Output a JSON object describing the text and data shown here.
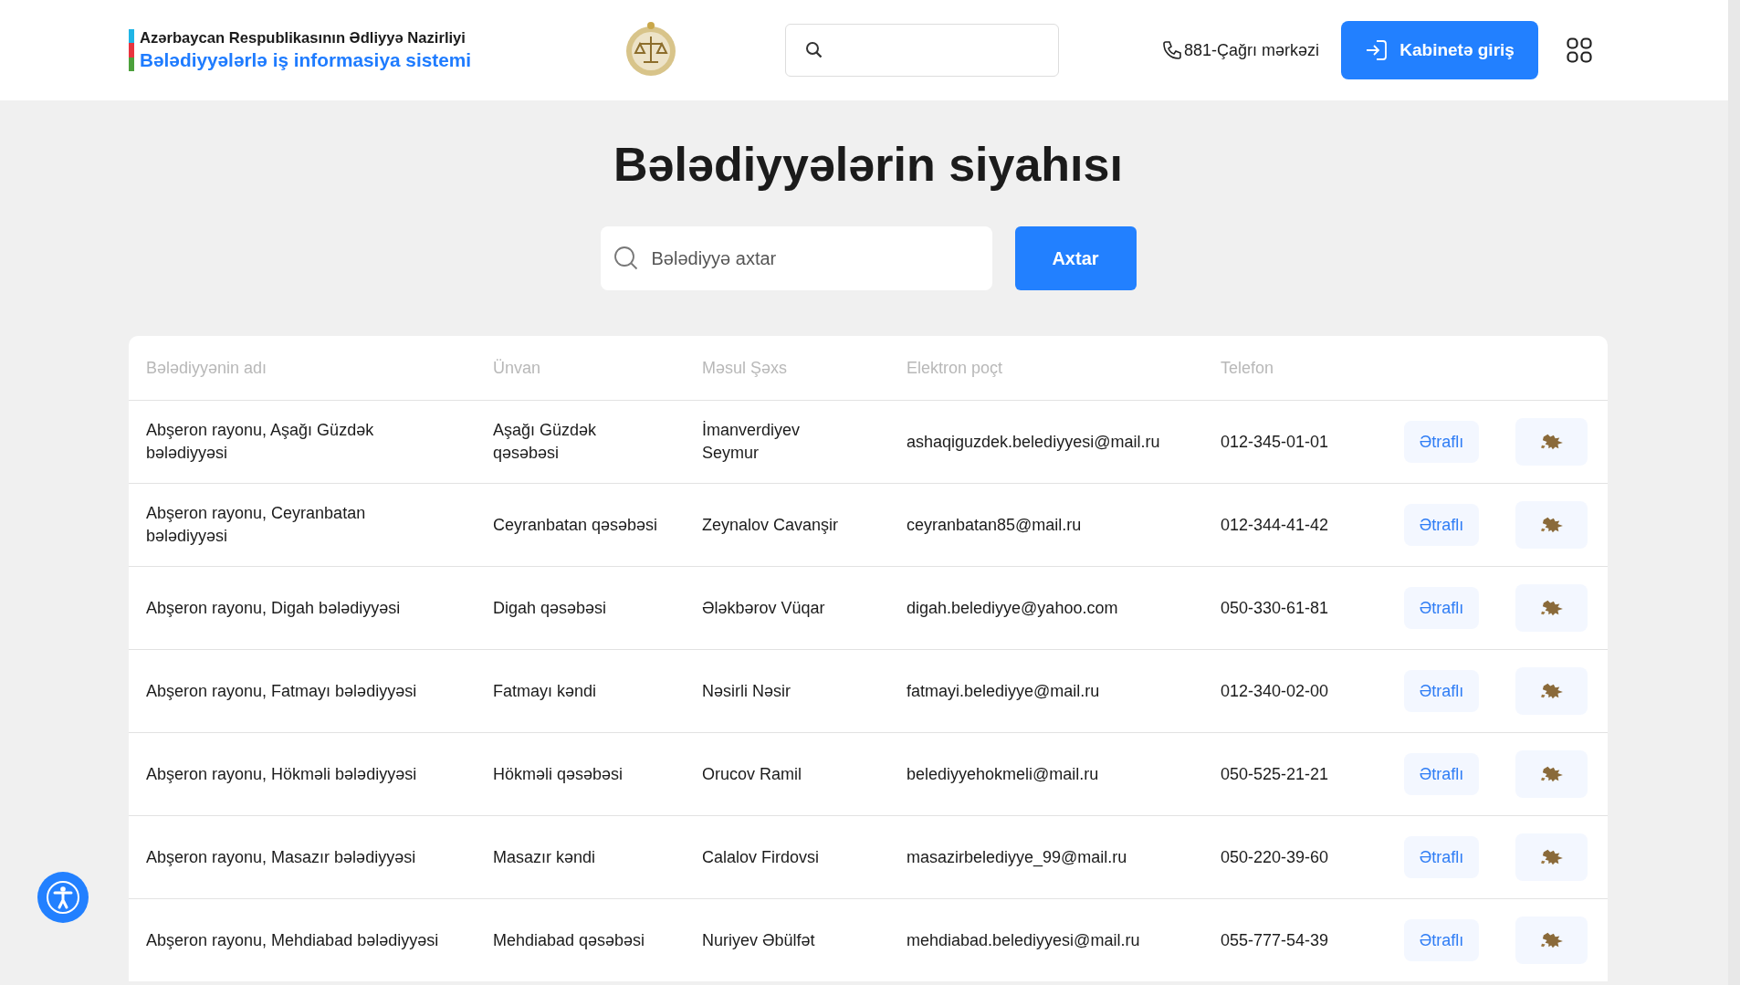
{
  "header": {
    "ministry": "Azərbaycan Respublikasının Ədliyyə Nazirliyi",
    "system": "Bələdiyyələrlə iş informasiya sistemi",
    "call_center": "881-Çağrı mərkəzi",
    "login_button": "Kabinetə giriş"
  },
  "page_title": "Bələdiyyələrin siyahısı",
  "search": {
    "placeholder": "Bələdiyyə axtar",
    "button": "Axtar"
  },
  "table": {
    "columns": [
      "Bələdiyyənin adı",
      "Ünvan",
      "Məsul Şəxs",
      "Elektron poçt",
      "Telefon"
    ],
    "rows": [
      {
        "name": "Abşeron rayonu, Aşağı Güzdək bələdiyyəsi",
        "address": "Aşağı Güzdək qəsəbəsi",
        "person": "İmanverdiyev Seymur",
        "email": "ashaqiguzdek.belediyyesi@mail.ru",
        "phone": "012-345-01-01",
        "detail_label": "Ətraflı"
      },
      {
        "name": "Abşeron rayonu, Ceyranbatan bələdiyyəsi",
        "address": "Ceyranbatan qəsəbəsi",
        "person": "Zeynalov Cavanşir",
        "email": "ceyranbatan85@mail.ru",
        "phone": "012-344-41-42",
        "detail_label": "Ətraflı"
      },
      {
        "name": "Abşeron rayonu, Digah bələdiyyəsi",
        "address": "Digah qəsəbəsi",
        "person": "Ələkbərov Vüqar",
        "email": "digah.belediyye@yahoo.com",
        "phone": "050-330-61-81",
        "detail_label": "Ətraflı"
      },
      {
        "name": "Abşeron rayonu, Fatmayı bələdiyyəsi",
        "address": "Fatmayı kəndi",
        "person": "Nəsirli Nəsir",
        "email": "fatmayi.belediyye@mail.ru",
        "phone": "012-340-02-00",
        "detail_label": "Ətraflı"
      },
      {
        "name": "Abşeron rayonu, Hökməli bələdiyyəsi",
        "address": "Hökməli qəsəbəsi",
        "person": "Orucov Ramil",
        "email": "belediyyehokmeli@mail.ru",
        "phone": "050-525-21-21",
        "detail_label": "Ətraflı"
      },
      {
        "name": "Abşeron rayonu, Masazır bələdiyyəsi",
        "address": "Masazır kəndi",
        "person": "Calalov Firdovsi",
        "email": "masazirbelediyye_99@mail.ru",
        "phone": "050-220-39-60",
        "detail_label": "Ətraflı"
      },
      {
        "name": "Abşeron rayonu, Mehdiabad bələdiyyəsi",
        "address": "Mehdiabad qəsəbəsi",
        "person": "Nuriyev Əbülfət",
        "email": "mehdiabad.belediyyesi@mail.ru",
        "phone": "055-777-54-39",
        "detail_label": "Ətraflı"
      }
    ]
  }
}
